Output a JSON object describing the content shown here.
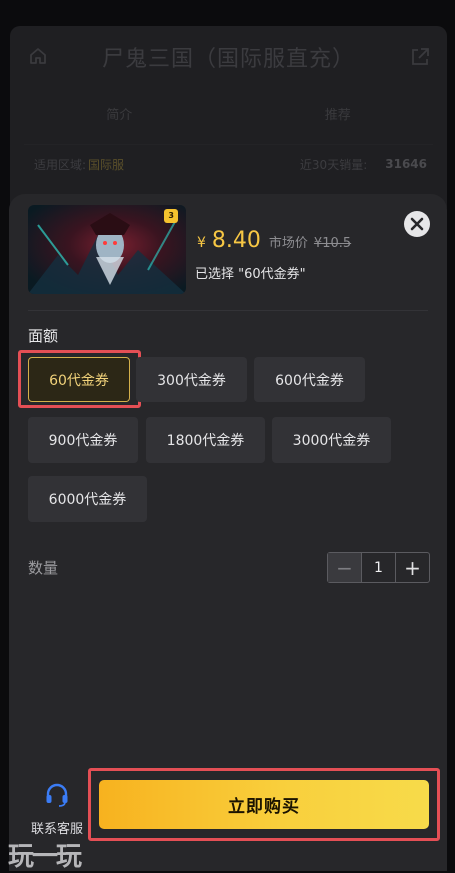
{
  "background_page": {
    "title": "尸鬼三国（国际服直充）",
    "tabs": [
      "简介",
      "推荐"
    ],
    "region_label": "适用区域:",
    "region_value": "国际服",
    "sales_label": "近30天销量:",
    "sales_value": "31646"
  },
  "product": {
    "badge": "3",
    "currency": "¥",
    "price": "8.40",
    "market_label": "市场价",
    "market_price": "¥10.5",
    "selected_text": "已选择 \"60代金券\""
  },
  "denomination": {
    "label": "面额",
    "options": [
      "60代金券",
      "300代金券",
      "600代金券",
      "900代金券",
      "1800代金券",
      "3000代金券",
      "6000代金券"
    ],
    "selected_index": 0
  },
  "quantity": {
    "label": "数量",
    "minus": "−",
    "value": "1",
    "plus": "+"
  },
  "footer": {
    "customer_service_label": "联系客服",
    "buy_label": "立即购买"
  },
  "watermark": "玩一玩",
  "colors": {
    "accent_gold": "#f7c744",
    "buy_gradient_start": "#f7b21f",
    "buy_gradient_end": "#f7db4a",
    "highlight_red": "#e44f55",
    "sheet_bg": "#27272a",
    "cs_icon_blue": "#3b7cf5"
  },
  "icons": {
    "home": "home-icon",
    "share": "share-icon",
    "close": "close-icon",
    "customer_service": "headset-icon"
  }
}
